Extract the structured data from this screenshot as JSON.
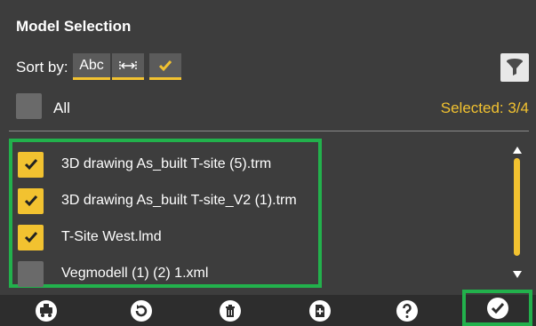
{
  "header": {
    "title": "Model Selection"
  },
  "sort": {
    "label": "Sort by:",
    "options": [
      {
        "name": "alphabetical",
        "label": "Abc"
      },
      {
        "name": "distance",
        "icon": "distance-icon"
      },
      {
        "name": "selected",
        "icon": "check-icon"
      }
    ]
  },
  "filter": {
    "icon": "filter-icon"
  },
  "select_all": {
    "label": "All",
    "checked": false
  },
  "selected_count": "Selected: 3/4",
  "models": [
    {
      "name": "3D drawing As_built T-site (5).trm",
      "checked": true
    },
    {
      "name": "3D drawing As_built T-site_V2 (1).trm",
      "checked": true
    },
    {
      "name": "T-Site West.lmd",
      "checked": true
    },
    {
      "name": "Vegmodell (1) (2) 1.xml",
      "checked": false
    }
  ],
  "toolbar": {
    "icons": [
      "machine-icon",
      "refresh-icon",
      "delete-icon",
      "add-file-icon",
      "help-icon",
      "confirm-icon"
    ]
  },
  "colors": {
    "accent": "#f2c230",
    "highlight": "#22b14c",
    "background": "#3d3d3d"
  }
}
